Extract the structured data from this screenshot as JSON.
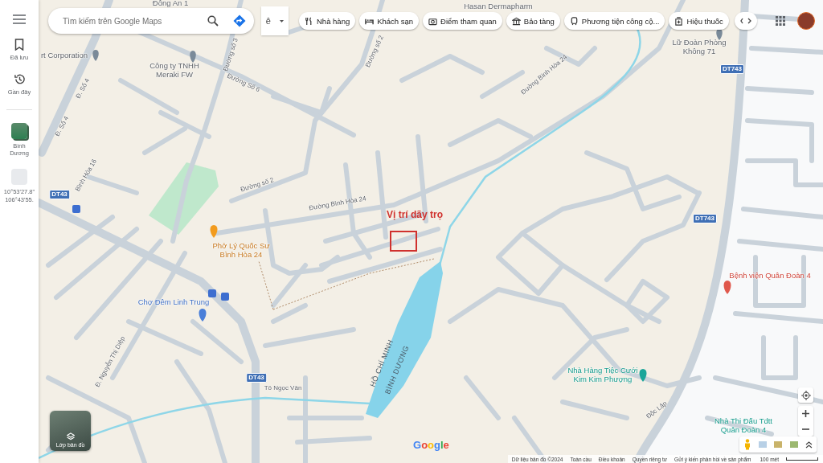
{
  "sidebar": {
    "items": [
      {
        "label": "Đã lưu",
        "kind": "saved"
      },
      {
        "label": "Gần đây",
        "kind": "recent"
      },
      {
        "label": "Bình\nDương",
        "kind": "place"
      },
      {
        "label": "10°53'27.8\"\n106°43'55.",
        "kind": "coords"
      }
    ]
  },
  "search": {
    "placeholder": "Tìm kiếm trên Google Maps"
  },
  "input_tool": {
    "label": "ê"
  },
  "chips": [
    {
      "label": "Nhà hàng",
      "kind": "restaurant"
    },
    {
      "label": "Khách sạn",
      "kind": "hotel"
    },
    {
      "label": "Điểm tham quan",
      "kind": "attraction"
    },
    {
      "label": "Bảo tàng",
      "kind": "museum"
    },
    {
      "label": "Phương tiện công cộ...",
      "kind": "transit"
    },
    {
      "label": "Hiệu thuốc",
      "kind": "pharmacy"
    }
  ],
  "map": {
    "labels": [
      {
        "text": "Đông An 1",
        "kind": "poi"
      },
      {
        "text": "rt Corporation",
        "kind": "poi"
      },
      {
        "text": "Công ty TNHH\nMeraki FW",
        "kind": "poi"
      },
      {
        "text": "Hasan Dermapharm",
        "kind": "poi"
      },
      {
        "text": "Lữ Đoàn Phòng\nKhông 71",
        "kind": "poi"
      },
      {
        "text": "Phở Lý Quốc Sư\nBình Hòa 24",
        "kind": "food"
      },
      {
        "text": "Chợ Đêm Linh Trung",
        "kind": "market"
      },
      {
        "text": "Bệnh viện Quân Đoàn 4",
        "kind": "hospital"
      },
      {
        "text": "Nhà Hàng Tiệc Cưới\nKim Kim Phượng",
        "kind": "venue"
      },
      {
        "text": "Nhà Thi Đấu Tdtt\nQuân Đoàn 4",
        "kind": "venue"
      },
      {
        "text": "Đ. Số 4",
        "kind": "street"
      },
      {
        "text": "Đ. Số 4",
        "kind": "street"
      },
      {
        "text": "Đường Số 6",
        "kind": "street"
      },
      {
        "text": "Đường số 3",
        "kind": "street"
      },
      {
        "text": "Đường số 2",
        "kind": "street"
      },
      {
        "text": "Đường số 2",
        "kind": "street"
      },
      {
        "text": "Đường Bình Hòa 24",
        "kind": "street"
      },
      {
        "text": "Đường Bình Hòa 24",
        "kind": "street"
      },
      {
        "text": "Bình Hòa 16",
        "kind": "street"
      },
      {
        "text": "Đ. Nguyễn Thị Diệp",
        "kind": "street"
      },
      {
        "text": "Tô Ngọc Vân",
        "kind": "street"
      },
      {
        "text": "Độc Lập",
        "kind": "street"
      },
      {
        "text": "HỒ CHÍ MINH",
        "kind": "boundary"
      },
      {
        "text": "BÌNH DƯƠNG",
        "kind": "boundary"
      }
    ],
    "road_shields": [
      "DT43",
      "DT43",
      "DT743",
      "DT743"
    ],
    "annotation": "Vị trí dãy trọ"
  },
  "layers_button": {
    "label": "Lớp bản đồ"
  },
  "logo": "Google",
  "footer": [
    "Dữ liệu bản đồ ©2024",
    "Toàn cầu",
    "Điều khoản",
    "Quyền riêng tư",
    "Gửi ý kiến phản hồi về sản phẩm"
  ],
  "scale": "100 mét"
}
